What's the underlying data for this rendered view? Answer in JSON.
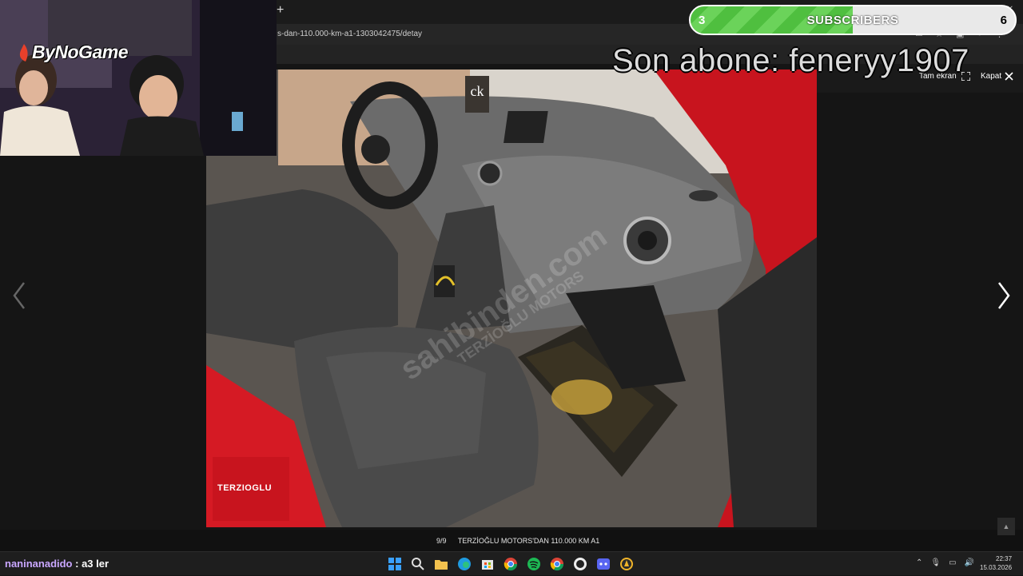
{
  "browser": {
    "new_tab": "+",
    "url": "s-dan-110.000-km-a1-1303042475/detay"
  },
  "viewer": {
    "fullscreen_label": "Tam ekran",
    "close_label": "Kapat",
    "counter": "9/9",
    "caption": "TERZİOĞLU MOTORS'DAN 110.000 KM A1",
    "watermark_main": "sahibinden.com",
    "watermark_sub": "TERZİOĞLU MOTORS",
    "dealer_logo": "TERZIOGLU",
    "brand_badge": "ck",
    "scroll_top": "▲"
  },
  "overlay": {
    "channel_logo": "ByNoGame",
    "sub_goal": {
      "current": "3",
      "label": "SUBSCRIBERS",
      "target": "6",
      "progress": 0.5
    },
    "last_sub": "Son abone: feneryy1907",
    "chat": {
      "user": "naninanadido",
      "message": ": a3 ler"
    }
  },
  "taskbar": {
    "time": "22:37",
    "date": "15.03.2026",
    "icons": [
      "windows-icon",
      "search-icon",
      "file-explorer-icon",
      "edge-icon",
      "store-icon",
      "chrome-icon",
      "spotify-icon",
      "chrome-icon",
      "github-icon",
      "app-icon",
      "app-icon"
    ]
  },
  "colors": {
    "accent_green": "#4fbf3f",
    "car_red": "#d51a24",
    "chat_user": "#c9a7ff"
  }
}
